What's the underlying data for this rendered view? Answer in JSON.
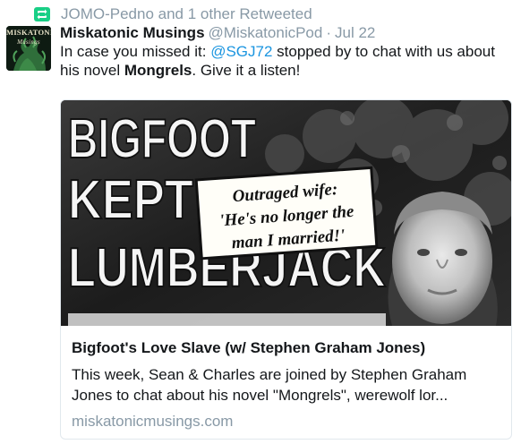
{
  "retweet": {
    "icon": "retweet-icon",
    "text": "JOMO-Pedno and 1 other Retweeted",
    "color": "#19cf86"
  },
  "tweet": {
    "avatar_label": "Miskatonic\nMusings",
    "name": "Miskatonic Musings",
    "handle": "@MiskatonicPod",
    "separator": "·",
    "date": "Jul 22",
    "text_part1": "In case you missed it: ",
    "mention": "@SGJ72",
    "text_part2": " stopped by to chat with us about his novel ",
    "bold_word": "Mongrels",
    "text_part3": ". Give it a listen!"
  },
  "card": {
    "image": {
      "headline_line1": "BIGFOOT",
      "headline_line2": "KEPT",
      "headline_line3": "LUMBERJACK",
      "callout_line1": "Outraged wife:",
      "callout_line2": "'He's no longer the",
      "callout_line3": "man I married!'"
    },
    "title": "Bigfoot's Love Slave (w/ Stephen Graham Jones)",
    "description": "This week, Sean & Charles are joined by Stephen Graham Jones to chat about his novel \"Mongrels\", werewolf lor...",
    "domain": "miskatonicmusings.com"
  },
  "colors": {
    "link": "#1b95e0",
    "muted": "#8899a6",
    "text": "#14171a",
    "border": "#e1e8ed"
  }
}
